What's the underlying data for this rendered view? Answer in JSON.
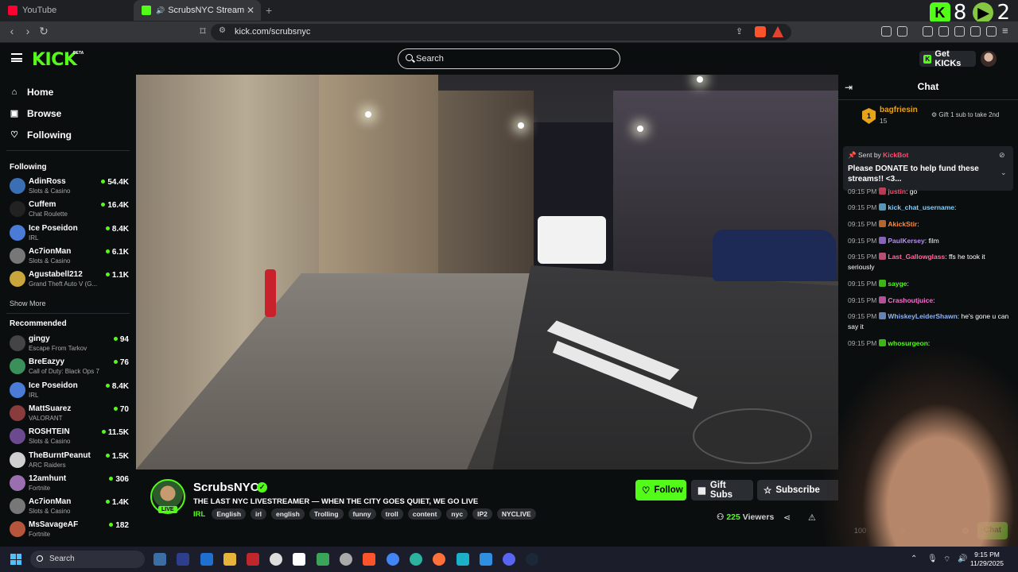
{
  "browser": {
    "tabs": [
      {
        "label": "YouTube",
        "active": false
      },
      {
        "label": "ScrubsNYC Stream - Watch Li",
        "active": true
      }
    ],
    "url": "kick.com/scrubsnyc",
    "counter_kick": "8",
    "counter_rumble": "2"
  },
  "header": {
    "logo": "KICK",
    "beta": "BETA",
    "search_placeholder": "Search",
    "get_kicks": "Get KICKs"
  },
  "sidebar": {
    "nav": [
      "Home",
      "Browse",
      "Following"
    ],
    "following_heading": "Following",
    "following": [
      {
        "name": "AdinRoss",
        "category": "Slots & Casino",
        "viewers": "54.4K",
        "color": "#3b6fb5"
      },
      {
        "name": "Cuffem",
        "category": "Chat Roulette",
        "viewers": "16.4K",
        "color": "#222"
      },
      {
        "name": "Ice Poseidon",
        "category": "IRL",
        "viewers": "8.4K",
        "color": "#4a7bd6"
      },
      {
        "name": "Ac7ionMan",
        "category": "Slots & Casino",
        "viewers": "6.1K",
        "color": "#777"
      },
      {
        "name": "Agustabell212",
        "category": "Grand Theft Auto V (G...",
        "viewers": "1.1K",
        "color": "#c9a63b"
      }
    ],
    "show_more": "Show More",
    "recommended_heading": "Recommended",
    "recommended": [
      {
        "name": "gingy",
        "category": "Escape From Tarkov",
        "viewers": "94",
        "color": "#444"
      },
      {
        "name": "BreEazyy",
        "category": "Call of Duty: Black Ops 7",
        "viewers": "76",
        "color": "#3a8f5a"
      },
      {
        "name": "Ice Poseidon",
        "category": "IRL",
        "viewers": "8.4K",
        "color": "#4a7bd6"
      },
      {
        "name": "MattSuarez",
        "category": "VALORANT",
        "viewers": "70",
        "color": "#8a3b3b"
      },
      {
        "name": "ROSHTEIN",
        "category": "Slots & Casino",
        "viewers": "11.5K",
        "color": "#6b4a8f"
      },
      {
        "name": "TheBurntPeanut",
        "category": "ARC Raiders",
        "viewers": "1.5K",
        "color": "#d0d0d0"
      },
      {
        "name": "12amhunt",
        "category": "Fortnite",
        "viewers": "306",
        "color": "#9a6fb0"
      },
      {
        "name": "Ac7ionMan",
        "category": "Slots & Casino",
        "viewers": "1.4K",
        "color": "#777"
      },
      {
        "name": "MsSavageAF",
        "category": "Fortnite",
        "viewers": "182",
        "color": "#b5553b"
      }
    ]
  },
  "channel": {
    "name": "ScrubsNYC",
    "live": "LIVE",
    "title": "THE LAST NYC LIVESTREAMER — WHEN THE CITY GOES QUIET, WE GO LIVE",
    "category": "IRL",
    "tags": [
      "English",
      "irl",
      "english",
      "Trolling",
      "funny",
      "troll",
      "content",
      "nyc",
      "IP2",
      "NYCLIVE"
    ],
    "follow": "Follow",
    "gift_subs": "Gift Subs",
    "subscribe": "Subscribe",
    "viewers_count": "225",
    "viewers_label": "Viewers"
  },
  "chat": {
    "title": "Chat",
    "top_gifter": {
      "name": "bagfriesin",
      "count": "15",
      "rank": "1"
    },
    "gift_prompt": "Gift 1 sub to take 2nd",
    "pinned": {
      "sent_by": "Sent by",
      "sender": "KickBot",
      "message": "Please DONATE to help fund these streams!! <3..."
    },
    "messages": [
      {
        "time": "09:15 PM",
        "user": "justin",
        "color": "#ff4d6d",
        "text": "go"
      },
      {
        "time": "09:15 PM",
        "user": "kick_chat_username",
        "color": "#7fd0ff",
        "text": ""
      },
      {
        "time": "09:15 PM",
        "user": "AkickStir",
        "color": "#ff8a3d",
        "text": ""
      },
      {
        "time": "09:15 PM",
        "user": "PaulKersey",
        "color": "#b98aff",
        "text": "film"
      },
      {
        "time": "09:15 PM",
        "user": "Last_Gallowglass",
        "color": "#ff6b9b",
        "text": "ffs he took it seriously"
      },
      {
        "time": "09:15 PM",
        "user": "sayge",
        "color": "#53fc18",
        "text": ""
      },
      {
        "time": "09:15 PM",
        "user": "Crashoutjuice",
        "color": "#ff6bd5",
        "text": ""
      },
      {
        "time": "09:15 PM",
        "user": "WhiskeyLeiderShawn",
        "color": "#8ab4ff",
        "text": "he's gone u can say it"
      },
      {
        "time": "09:15 PM",
        "user": "whosurgeon",
        "color": "#53fc18",
        "text": ""
      }
    ],
    "chat_button": "Chat",
    "kicks_count": "100",
    "zero": "0"
  },
  "taskbar": {
    "search": "Search",
    "time": "9:15 PM",
    "date": "11/29/2025"
  },
  "colors": {
    "kick_green": "#53fc18",
    "background": "#0b0e0f"
  }
}
